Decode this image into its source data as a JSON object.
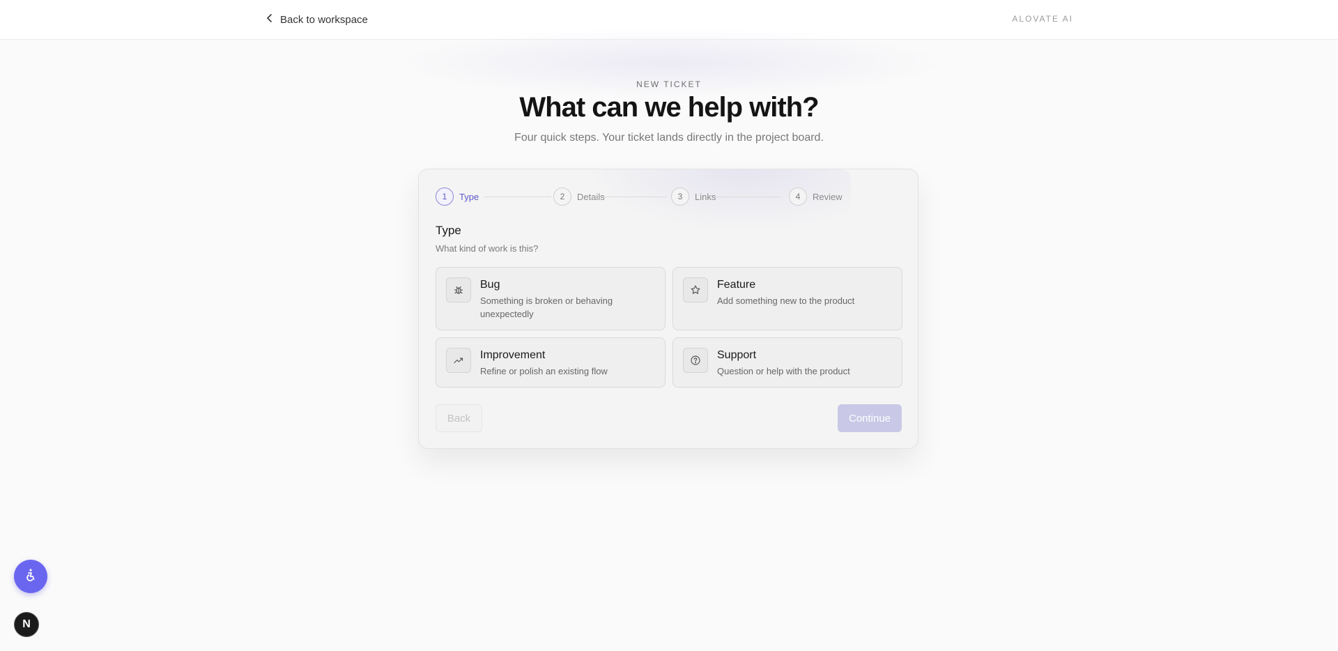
{
  "header": {
    "back_label": "Back to workspace",
    "brand": "ALOVATE AI"
  },
  "hero": {
    "eyebrow": "NEW TICKET",
    "title": "What can we help with?",
    "subtitle": "Four quick steps. Your ticket lands directly in the project board."
  },
  "stepper": {
    "active_step": 1,
    "steps": [
      {
        "number": "1",
        "label": "Type"
      },
      {
        "number": "2",
        "label": "Details"
      },
      {
        "number": "3",
        "label": "Links"
      },
      {
        "number": "4",
        "label": "Review"
      }
    ]
  },
  "section": {
    "title": "Type",
    "subtitle": "What kind of work is this?"
  },
  "options": [
    {
      "title": "Bug",
      "description": "Something is broken or behaving unexpectedly",
      "icon": "bug-icon"
    },
    {
      "title": "Feature",
      "description": "Add something new to the product",
      "icon": "star-icon"
    },
    {
      "title": "Improvement",
      "description": "Refine or polish an existing flow",
      "icon": "trending-up-icon"
    },
    {
      "title": "Support",
      "description": "Question or help with the product",
      "icon": "help-circle-icon"
    }
  ],
  "actions": {
    "back_label": "Back",
    "continue_label": "Continue"
  },
  "floating": {
    "accessibility_icon": "accessibility-icon",
    "badge_letter": "N"
  },
  "colors": {
    "accent": "#6b66f0",
    "active_step": "#5b57c8",
    "continue_disabled": "#c9c8e6"
  }
}
